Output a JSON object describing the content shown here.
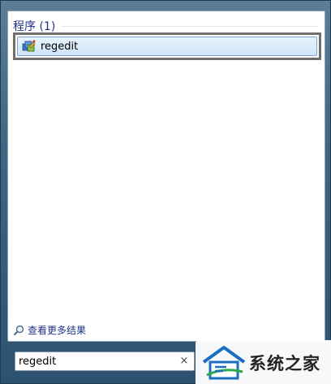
{
  "results": {
    "group_header": "程序 (1)",
    "items": [
      {
        "label": "regedit",
        "icon": "registry-editor-icon"
      }
    ],
    "more_results_label": "查看更多结果"
  },
  "search": {
    "value": "regedit",
    "clear_symbol": "×"
  },
  "watermark": {
    "text": "系统之家"
  },
  "colors": {
    "header_blue": "#1e3287",
    "selection_fill": "#cfe5fa",
    "selection_border": "#7da2ce",
    "outline_gray": "#6f6f6f"
  }
}
